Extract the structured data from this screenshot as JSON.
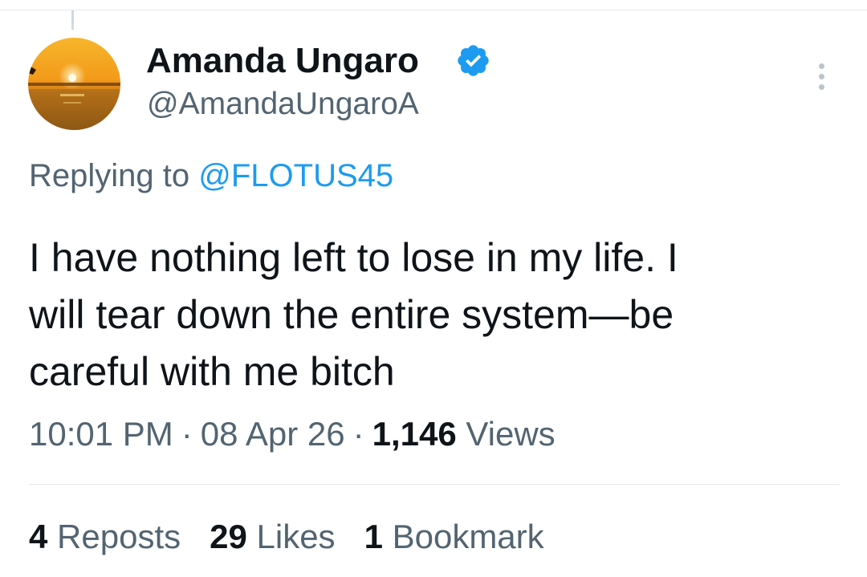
{
  "tweet": {
    "author": {
      "display_name": "Amanda Ungaro",
      "handle": "@AmandaUngaroA",
      "verified": true,
      "avatar_icon": "sunset-photo-avatar"
    },
    "reply": {
      "prefix": "Replying to",
      "mention": "@FLOTUS45"
    },
    "text": "I have nothing left to lose in my life. I\nwill tear down the entire system—be\ncareful with me bitch",
    "meta": {
      "time": "10:01 PM",
      "separator": "·",
      "date": "08 Apr 26",
      "views_count": "1,146",
      "views_label": "Views"
    },
    "stats": [
      {
        "count": "4",
        "label": "Reposts"
      },
      {
        "count": "29",
        "label": "Likes"
      },
      {
        "count": "1",
        "label": "Bookmark"
      }
    ],
    "icons": {
      "verified": "verified-badge-icon",
      "more": "more-options-icon"
    },
    "colors": {
      "text": "#0f1419",
      "secondary": "#536471",
      "accent": "#1d9bf0",
      "divider": "#e6e9ec"
    }
  }
}
